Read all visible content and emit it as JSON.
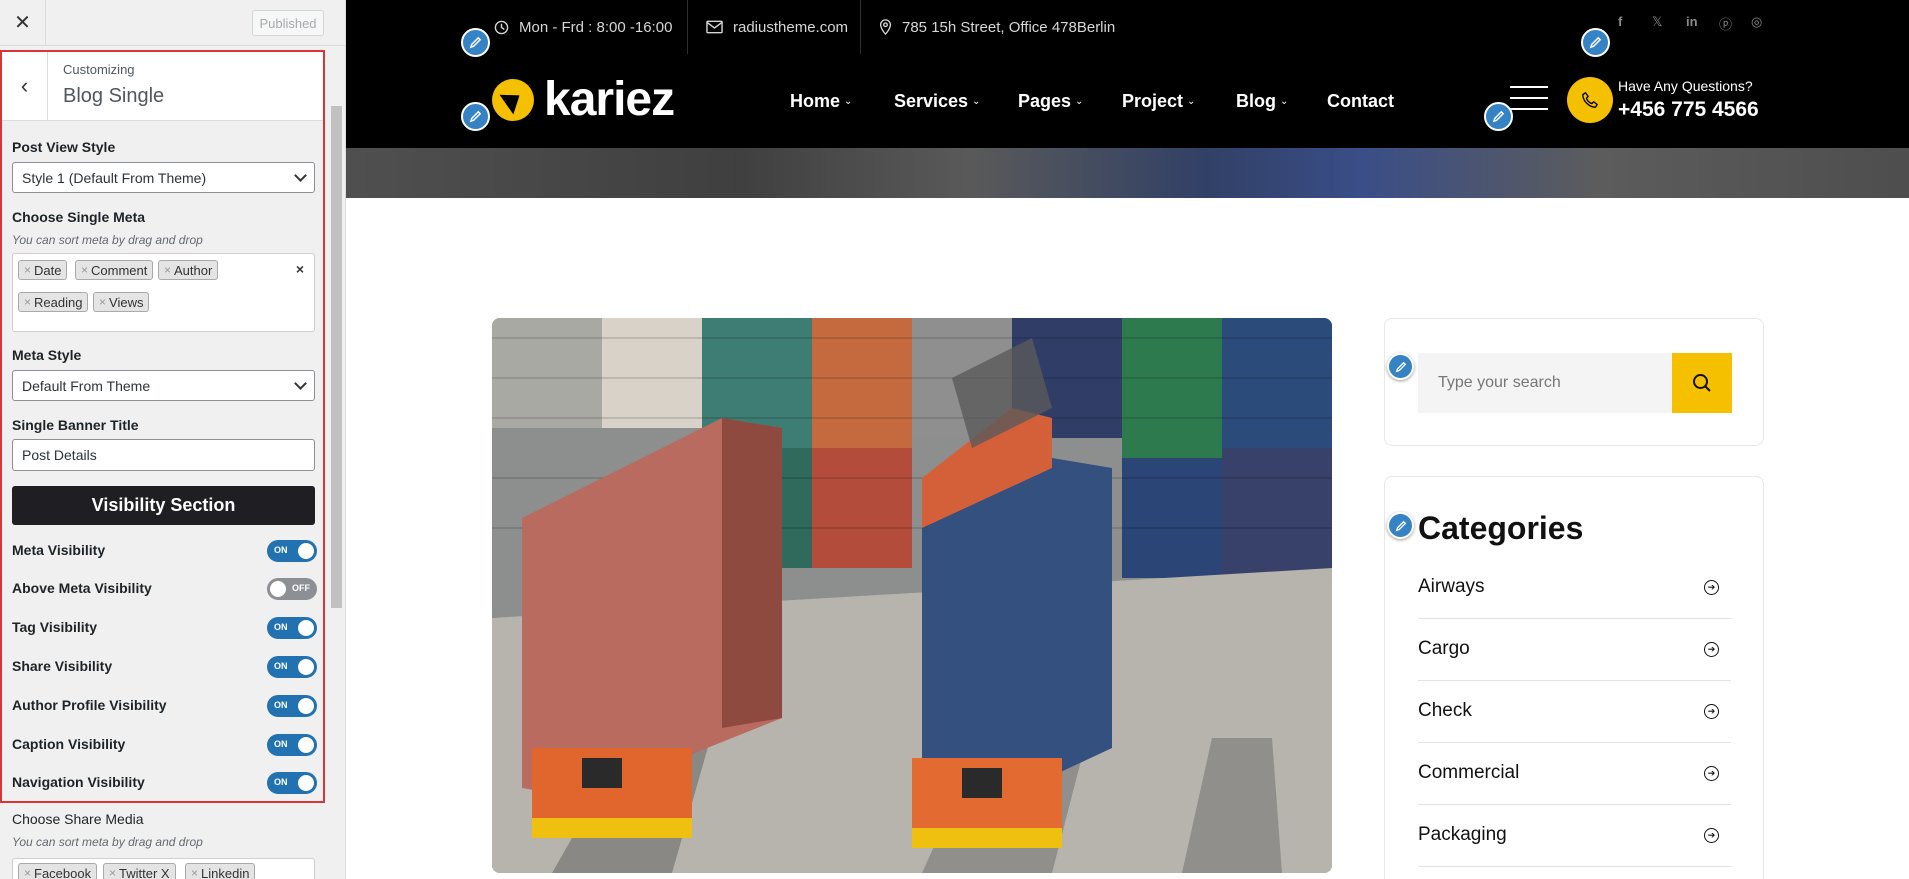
{
  "customizer": {
    "close_icon": "close-icon",
    "publish_label": "Published",
    "section_eyebrow": "Customizing",
    "section_title": "Blog Single",
    "post_view_style": {
      "label": "Post View Style",
      "value": "Style 1 (Default From Theme)"
    },
    "single_meta": {
      "label": "Choose Single Meta",
      "description": "You can sort meta by drag and drop",
      "tags": [
        "Date",
        "Comment",
        "Author",
        "Reading",
        "Views"
      ],
      "remove_glyph": "×",
      "clear_glyph": "×"
    },
    "meta_style": {
      "label": "Meta Style",
      "value": "Default From Theme"
    },
    "banner_title": {
      "label": "Single Banner Title",
      "value": "Post Details"
    },
    "visibility_heading": "Visibility Section",
    "toggles": [
      {
        "label": "Meta Visibility",
        "state": "ON"
      },
      {
        "label": "Above Meta Visibility",
        "state": "OFF"
      },
      {
        "label": "Tag Visibility",
        "state": "ON"
      },
      {
        "label": "Share Visibility",
        "state": "ON"
      },
      {
        "label": "Author Profile Visibility",
        "state": "ON"
      },
      {
        "label": "Caption Visibility",
        "state": "ON"
      },
      {
        "label": "Navigation Visibility",
        "state": "ON"
      }
    ],
    "share_media": {
      "label": "Choose Share Media",
      "description": "You can sort meta by drag and drop",
      "tags": [
        "Facebook",
        "Twitter X",
        "Linkedin"
      ]
    },
    "colors": {
      "highlight_border": "#d63638",
      "toggle_on": "#2271b1",
      "toggle_off": "#8c8f94"
    }
  },
  "site": {
    "topbar": {
      "hours": "Mon - Frd : 8:00 -16:00",
      "email": "radiustheme.com",
      "address": "785 15h Street, Office 478Berlin",
      "social": [
        "facebook-icon",
        "x-icon",
        "linkedin-icon",
        "pinterest-icon",
        "instagram-icon"
      ]
    },
    "logo_text": "kariez",
    "nav": [
      "Home",
      "Services",
      "Pages",
      "Project",
      "Blog",
      "Contact"
    ],
    "nav_caret": "⌄",
    "phone_question": "Have Any Questions?",
    "phone_number": "+456 775 4566",
    "search_placeholder": "Type your search",
    "categories_title": "Categories",
    "categories": [
      "Airways",
      "Cargo",
      "Check",
      "Commercial",
      "Packaging"
    ],
    "category_arrow": "➔",
    "colors": {
      "accent": "#f5c000",
      "dark": "#000000"
    }
  }
}
